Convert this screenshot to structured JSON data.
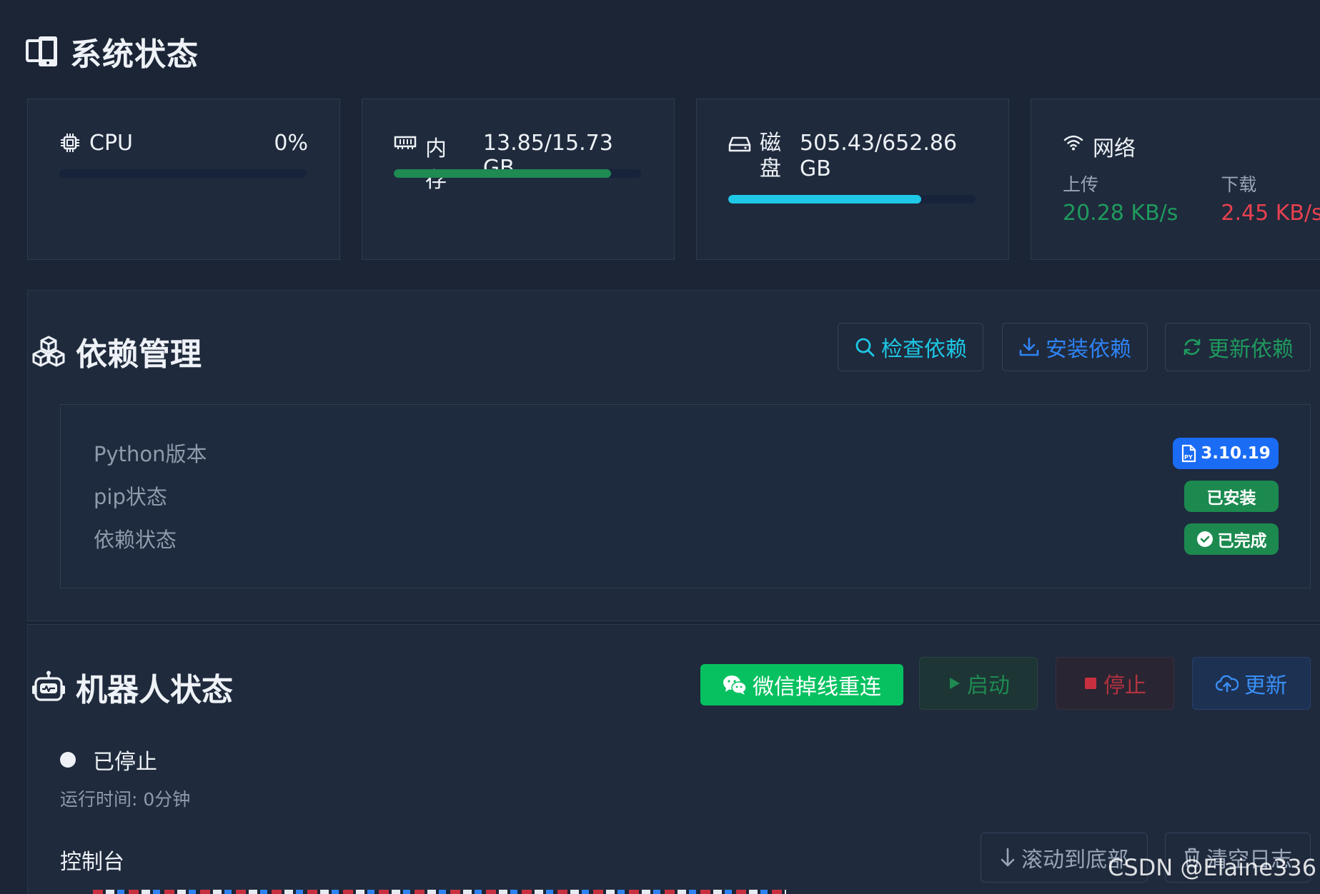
{
  "system": {
    "title": "系统状态",
    "cpu": {
      "label": "CPU",
      "value": "0%",
      "percent": 0
    },
    "memory": {
      "label": "内存",
      "value": "13.85/15.73 GB",
      "percent": 88
    },
    "disk": {
      "label_line1": "磁",
      "label_line2": "盘",
      "value_line1": "505.43/652.86",
      "value_line2": "GB",
      "percent": 78
    },
    "network": {
      "label": "网络",
      "upload_label": "上传",
      "upload_value": "20.28 KB/s",
      "download_label": "下载",
      "download_value": "2.45 KB/s"
    }
  },
  "deps": {
    "title": "依赖管理",
    "check_label": "检查依赖",
    "install_label": "安装依赖",
    "update_label": "更新依赖",
    "python_label": "Python版本",
    "python_value": "3.10.19",
    "pip_label": "pip状态",
    "pip_value": "已安装",
    "dep_label": "依赖状态",
    "dep_value": "已完成"
  },
  "bot": {
    "title": "机器人状态",
    "reconnect_label": "微信掉线重连",
    "start_label": "启动",
    "stop_label": "停止",
    "update_label": "更新",
    "status_text": "已停止",
    "uptime_text": "运行时间: 0分钟",
    "console_label": "控制台",
    "scroll_label": "滚动到底部",
    "clear_label": "清空日志"
  },
  "watermark": "CSDN @Elaine336",
  "colors": {
    "bg": "#1b2536",
    "card": "#1f2a3c",
    "cyan": "#1ec8e6",
    "green": "#1f8a52",
    "blue": "#2a6cf0",
    "red": "#e8414f",
    "wechat": "#07c160"
  }
}
